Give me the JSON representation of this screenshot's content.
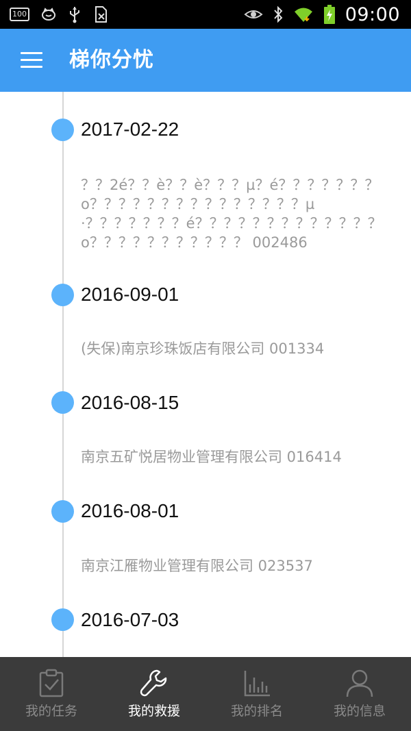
{
  "status_bar": {
    "battery_level": "100",
    "time": "09:00"
  },
  "header": {
    "title": "梯你分忧"
  },
  "timeline": [
    {
      "date": "2017-02-22",
      "description": "？？2é？？è？？è？？？µ？é？？？？？？？o？？？？？？？？？？？？？？？µ·？？？？？？？é？？？？？？？？？？？？？o？？？？？？？？？？？  002486"
    },
    {
      "date": "2016-09-01",
      "description": "(失保)南京珍珠饭店有限公司  001334"
    },
    {
      "date": "2016-08-15",
      "description": "南京五矿悦居物业管理有限公司  016414"
    },
    {
      "date": "2016-08-01",
      "description": "南京江雁物业管理有限公司  023537"
    },
    {
      "date": "2016-07-03",
      "description": ""
    }
  ],
  "bottom_nav": {
    "items": [
      {
        "label": "我的任务",
        "icon": "clipboard-check-icon",
        "active": false
      },
      {
        "label": "我的救援",
        "icon": "wrench-icon",
        "active": true
      },
      {
        "label": "我的排名",
        "icon": "bar-chart-icon",
        "active": false
      },
      {
        "label": "我的信息",
        "icon": "user-icon",
        "active": false
      }
    ]
  },
  "colors": {
    "header": "#3f9cf2",
    "timeline_dot": "#5cb3fb",
    "nav_background": "#3b3b3b"
  }
}
